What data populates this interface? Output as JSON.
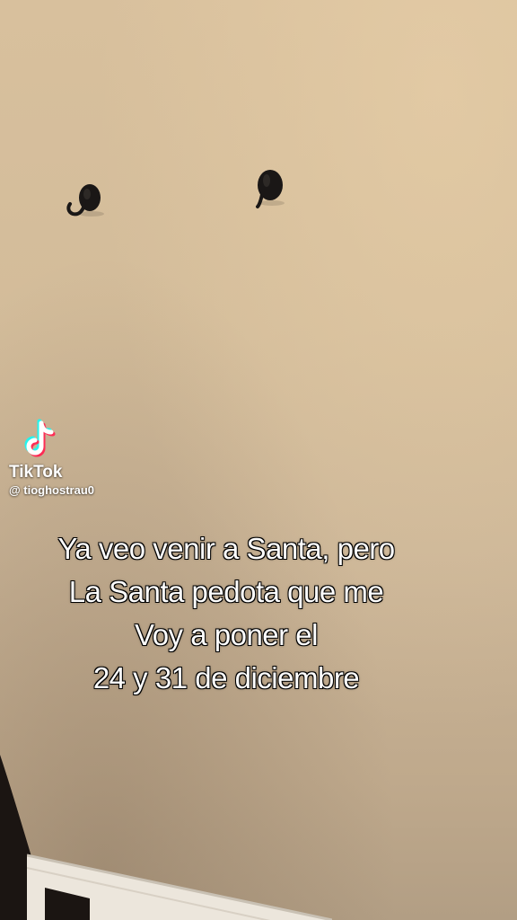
{
  "watermark": {
    "brand": "TikTok",
    "handle": "@ tioghostrau0",
    "logo_icon": "tiktok-note-icon"
  },
  "caption": {
    "lines": [
      "Ya veo venir a Santa, pero",
      "La Santa pedota que me",
      "Voy a poner el",
      "24 y 31 de diciembre"
    ]
  },
  "colors": {
    "wall": "#d3bc9a",
    "hook": "#1a1716",
    "text": "#ffffff",
    "tiktok_cyan": "#25f4ee",
    "tiktok_red": "#fe2c55"
  }
}
